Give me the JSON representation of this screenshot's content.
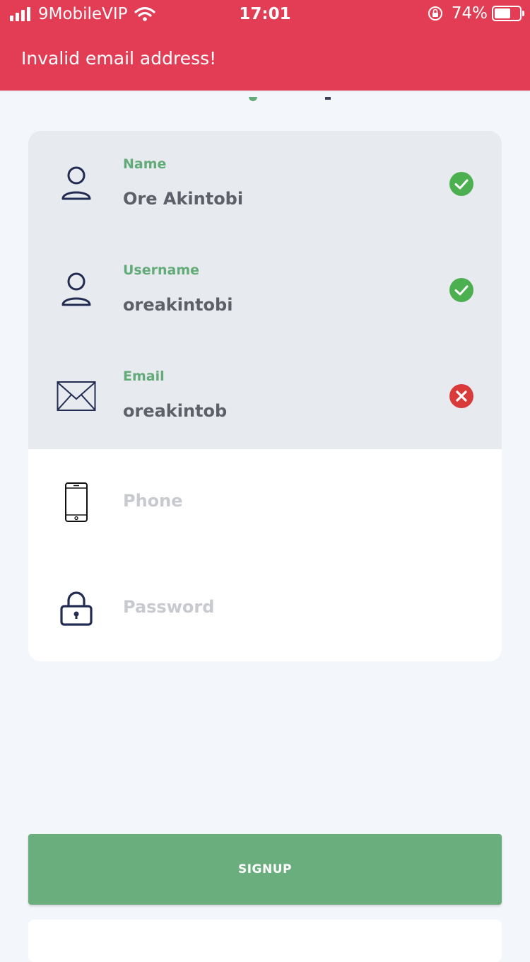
{
  "status_bar": {
    "carrier": "9MobileVIP",
    "time": "17:01",
    "battery": "74%",
    "battery_level": 0.74
  },
  "banner": {
    "message": "Invalid email address!",
    "color": "#e23d55"
  },
  "form": {
    "fields": [
      {
        "label": "Name",
        "value": "Ore Akintobi",
        "icon": "user-icon",
        "status": "valid"
      },
      {
        "label": "Username",
        "value": "oreakintobi",
        "icon": "user-icon",
        "status": "valid"
      },
      {
        "label": "Email",
        "value": "oreakintob",
        "icon": "envelope-icon",
        "status": "invalid"
      },
      {
        "placeholder": "Phone",
        "icon": "smartphone-icon"
      },
      {
        "placeholder": "Password",
        "icon": "lock-icon"
      }
    ]
  },
  "signup_label": "SIGNUP",
  "colors": {
    "accent_green": "#6aae7d",
    "valid": "#4caf50",
    "invalid": "#d93a3a",
    "icon_navy": "#232c52"
  }
}
